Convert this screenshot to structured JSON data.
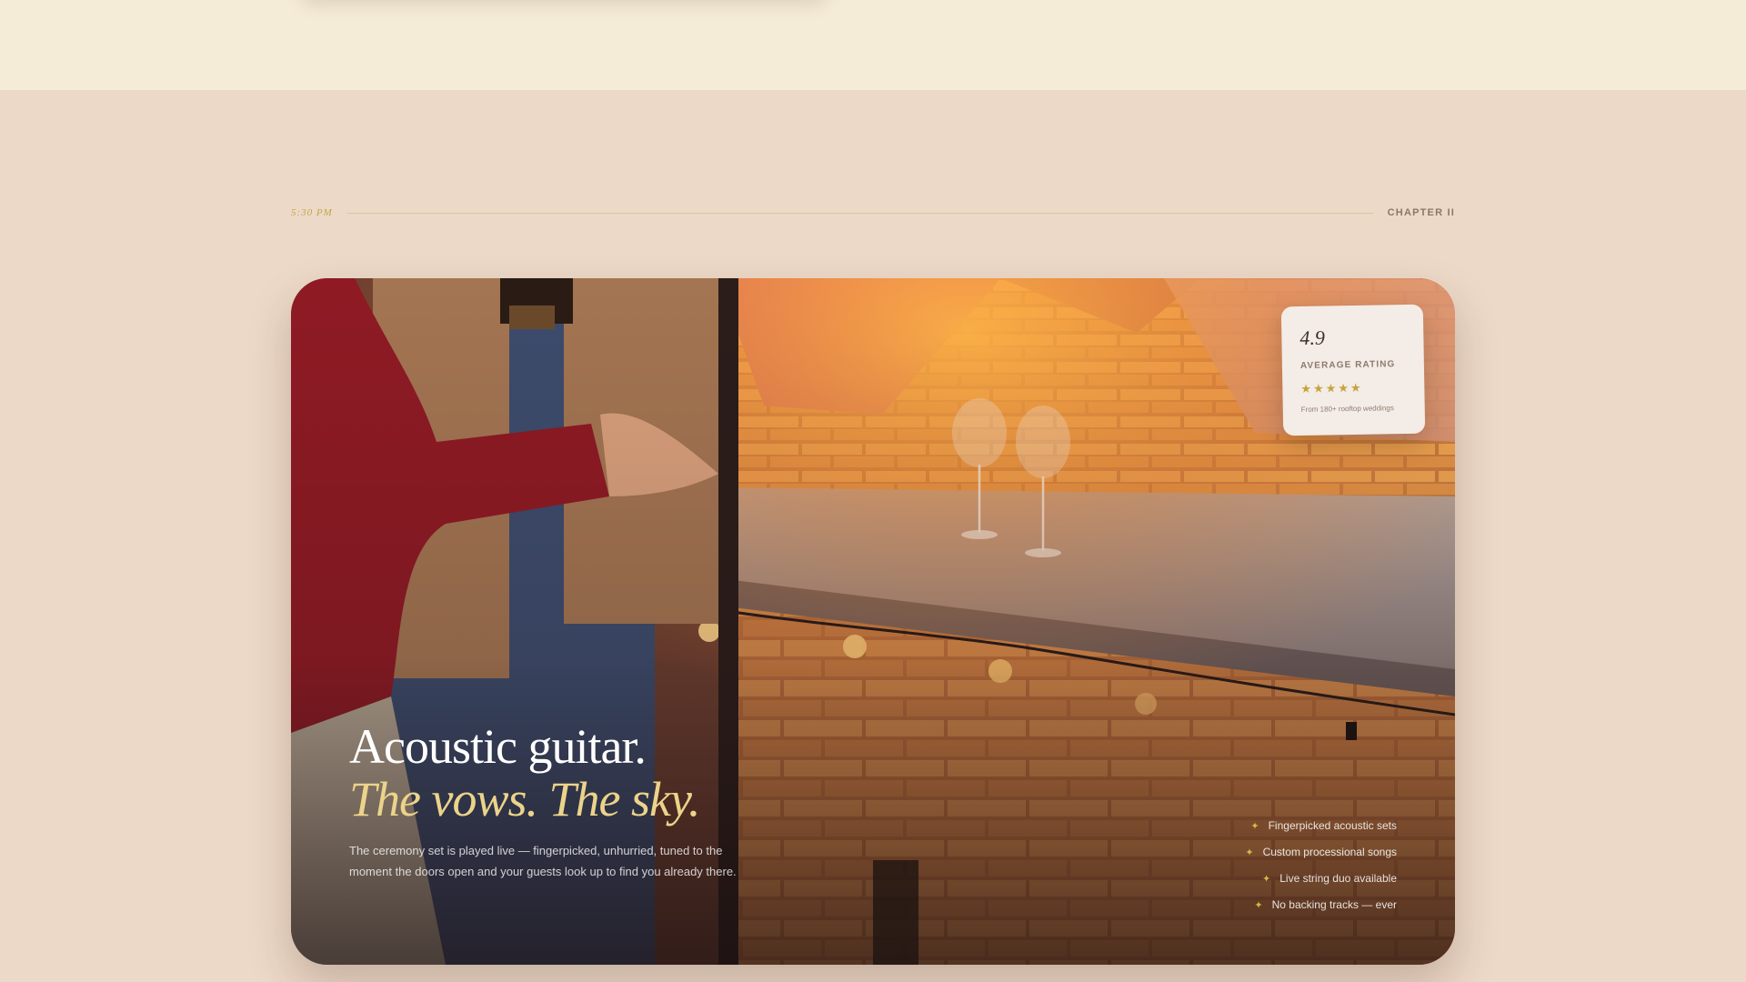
{
  "chapter": {
    "time": "5:30 PM",
    "label": "CHAPTER II"
  },
  "hero": {
    "title_line1": "Acoustic guitar.",
    "title_line2": "The vows. The sky.",
    "description": "The ceremony set is played live — fingerpicked, unhurried, tuned to the moment the doors open and your guests look up to find you already there."
  },
  "rating": {
    "value": "4.9",
    "label": "AVERAGE RATING",
    "stars": "★★★★★",
    "stars_count": 5,
    "subtext": "From 180+ rooftop weddings"
  },
  "features": [
    "Fingerpicked acoustic sets",
    "Custom processional songs",
    "Live string duo available",
    "No backing tracks — ever"
  ],
  "icons": {
    "feature_bullet": "sparkle-icon",
    "feature_bullet_glyph": "✦"
  },
  "colors": {
    "page_bg": "#edd9c8",
    "top_band": "#f5ecd8",
    "accent_gold": "#ecd38a",
    "star_gold": "#c5a43e"
  }
}
